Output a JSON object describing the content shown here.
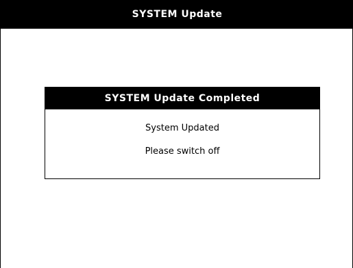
{
  "window": {
    "title": "SYSTEM Update"
  },
  "dialog": {
    "title": "SYSTEM Update Completed",
    "message_line1": "System Updated",
    "message_line2": "Please switch off"
  },
  "colors": {
    "background": "#ffffff",
    "bar": "#000000",
    "text_on_bar": "#ffffff",
    "text": "#000000"
  }
}
